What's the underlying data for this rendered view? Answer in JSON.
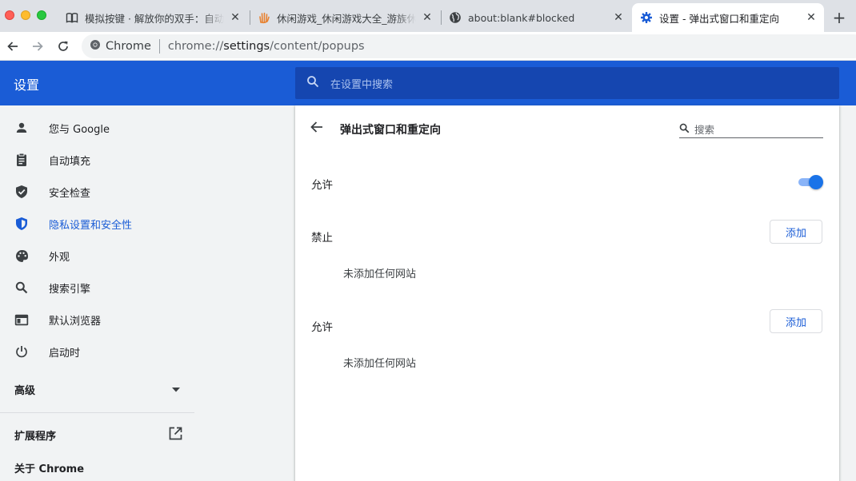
{
  "tabs": [
    {
      "title": "模拟按键 · 解放你的双手：自动化",
      "favicon": "book-icon",
      "active": false
    },
    {
      "title": "休闲游戏_休闲游戏大全_游族休闲",
      "favicon": "hand-icon",
      "active": false
    },
    {
      "title": "about:blank#blocked",
      "favicon": "globe-icon",
      "active": false
    },
    {
      "title": "设置 - 弹出式窗口和重定向",
      "favicon": "gear-icon",
      "active": true
    }
  ],
  "omnibox": {
    "chip": "Chrome",
    "url_prefix": "chrome://",
    "url_host": "settings",
    "url_path": "/content/popups"
  },
  "header": {
    "title": "设置",
    "search_placeholder": "在设置中搜索"
  },
  "sidebar": {
    "items": [
      {
        "label": "您与 Google",
        "icon": "person-icon"
      },
      {
        "label": "自动填充",
        "icon": "clipboard-icon"
      },
      {
        "label": "安全检查",
        "icon": "shield-check-icon"
      },
      {
        "label": "隐私设置和安全性",
        "icon": "privacy-shield-icon",
        "active": true
      },
      {
        "label": "外观",
        "icon": "palette-icon"
      },
      {
        "label": "搜索引擎",
        "icon": "search-icon"
      },
      {
        "label": "默认浏览器",
        "icon": "browser-icon"
      },
      {
        "label": "启动时",
        "icon": "power-icon"
      }
    ],
    "advanced_label": "高级",
    "extensions_label": "扩展程序",
    "about_label": "关于 Chrome"
  },
  "page": {
    "title": "弹出式窗口和重定向",
    "search_placeholder": "搜索",
    "allow_toggle_label": "允许",
    "allow_toggle_on": true,
    "blocked_heading": "禁止",
    "blocked_add_label": "添加",
    "blocked_empty": "未添加任何网站",
    "allowed_heading": "允许",
    "allowed_add_label": "添加",
    "allowed_empty": "未添加任何网站"
  },
  "colors": {
    "accent": "#1a5cd6",
    "header_bg": "#1a5cd6",
    "search_bg": "#1546b0"
  }
}
